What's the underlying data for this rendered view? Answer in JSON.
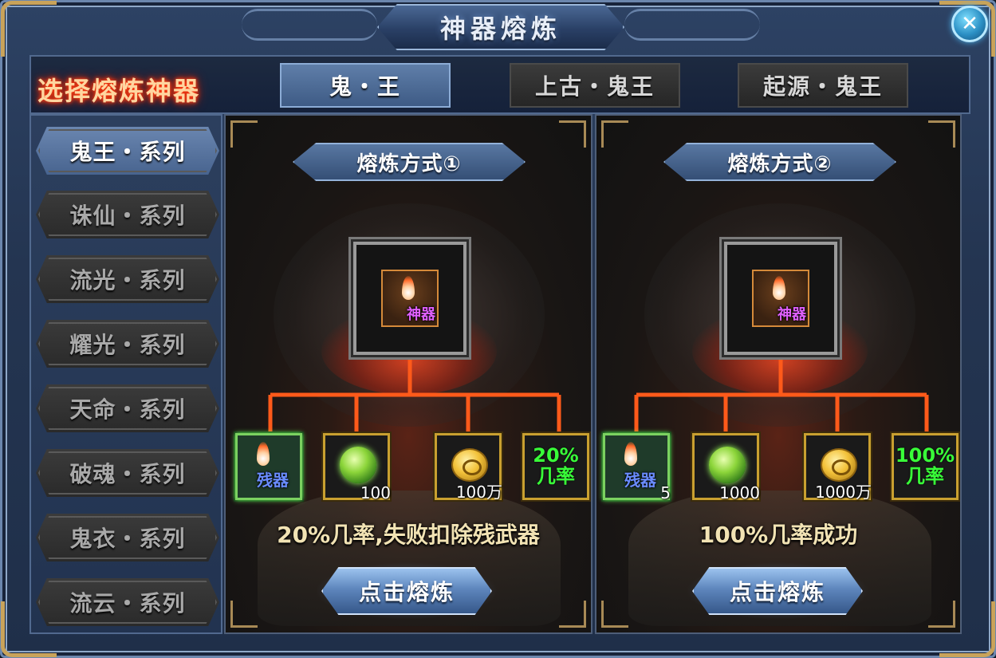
{
  "window": {
    "title": "神器熔炼",
    "close_icon": "close-icon"
  },
  "header": {
    "select_label": "选择熔炼神器",
    "tabs": [
      {
        "label": "鬼・王",
        "active": true
      },
      {
        "label": "上古・鬼王",
        "active": false
      },
      {
        "label": "起源・鬼王",
        "active": false
      }
    ]
  },
  "sidebar": {
    "items": [
      {
        "label": "鬼王・系列",
        "active": true
      },
      {
        "label": "诛仙・系列",
        "active": false
      },
      {
        "label": "流光・系列",
        "active": false
      },
      {
        "label": "耀光・系列",
        "active": false
      },
      {
        "label": "天命・系列",
        "active": false
      },
      {
        "label": "破魂・系列",
        "active": false
      },
      {
        "label": "鬼衣・系列",
        "active": false
      },
      {
        "label": "流云・系列",
        "active": false
      }
    ]
  },
  "methods": [
    {
      "title": "熔炼方式①",
      "target_label": "神器",
      "materials": {
        "fragment_label": "残器",
        "fragment_count": "",
        "orb_count": "100",
        "coin_count": "100万",
        "rate_value": "20%",
        "rate_label": "几率"
      },
      "description": "20%几率,失败扣除残武器",
      "button_label": "点击熔炼"
    },
    {
      "title": "熔炼方式②",
      "target_label": "神器",
      "materials": {
        "fragment_label": "残器",
        "fragment_count": "5",
        "orb_count": "1000",
        "coin_count": "1000万",
        "rate_value": "100%",
        "rate_label": "几率"
      },
      "description": "100%几率成功",
      "button_label": "点击熔炼"
    }
  ],
  "colors": {
    "frame": "#243551",
    "accent_blue": "#6a86b0",
    "gold_border": "#c9a030",
    "rate_green": "#39ff39",
    "artifact_purple": "#e060ff",
    "title_glow_red": "#ff3a10"
  }
}
